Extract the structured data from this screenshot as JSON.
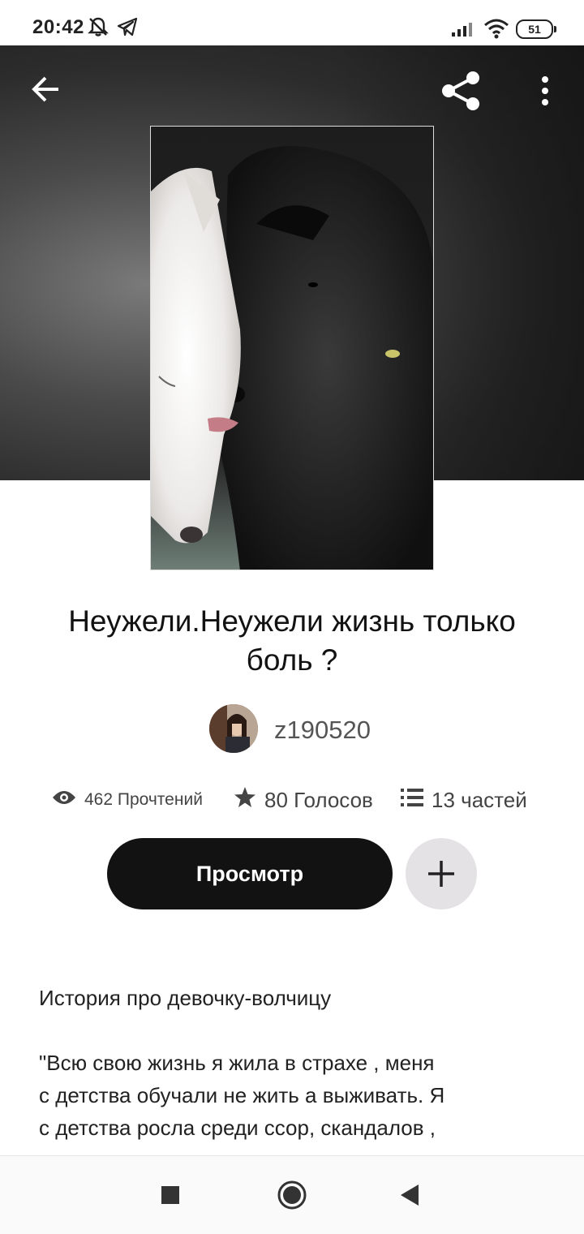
{
  "status_bar": {
    "time": "20:42",
    "battery": "51",
    "icons": [
      "notifications-off-icon",
      "telegram-icon",
      "signal-icon",
      "wifi-icon",
      "battery-icon"
    ]
  },
  "header": {
    "icons": [
      "back-arrow-icon",
      "share-icon",
      "more-vertical-icon"
    ]
  },
  "story": {
    "title": "Неужели.Неужели жизнь только боль ?",
    "author": "z190520",
    "stats": {
      "reads": "462 Прочтений",
      "votes": "80 Голосов",
      "parts": "13 частей"
    },
    "read_button": "Просмотр",
    "description": [
      "История про девочку-волчицу",
      "\"Всю свою жизнь я жила в страхе , меня",
      "с детства обучали не жить а выживать. Я",
      "с детства росла среди ссор, скандалов ,"
    ]
  },
  "navbar": {
    "icons": [
      "recents-icon",
      "home-icon",
      "back-icon"
    ]
  },
  "colors": {
    "primary_button": "#121212",
    "secondary_button": "#e4e2e4",
    "text": "#121212"
  }
}
